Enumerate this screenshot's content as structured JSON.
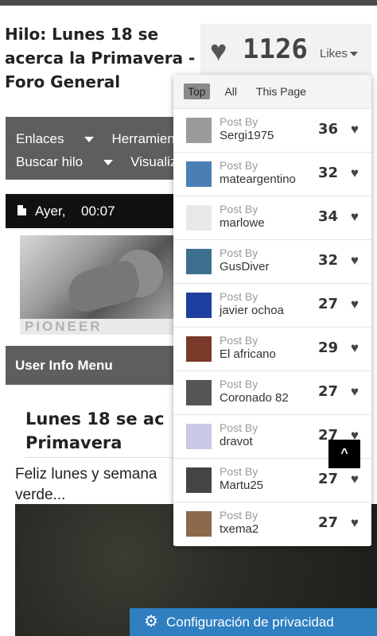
{
  "thread": {
    "title": "Hilo: Lunes 18 se acerca la Primavera - Foro General"
  },
  "navbar": {
    "items": [
      {
        "label": "Enlaces",
        "has_caret": true
      },
      {
        "label": "Herramient",
        "has_caret": false
      },
      {
        "label": "Buscar hilo",
        "has_caret": true
      },
      {
        "label": "Visualiz",
        "has_caret": false
      }
    ]
  },
  "post": {
    "date": "Ayer,",
    "time": "00:07",
    "avatar_plate_text": "PIONEER",
    "user_info_menu": "User Info Menu",
    "title": "Lunes 18 se ac Primavera",
    "title_line1": "Lunes 18 se ac",
    "title_line2": "Primavera",
    "excerpt_line1": "Feliz lunes y semana",
    "excerpt_line2": "verde..."
  },
  "likes": {
    "count": "1126",
    "label": "Likes",
    "heart_icon": "heart-icon",
    "tabs": [
      {
        "label": "Top",
        "active": true
      },
      {
        "label": "All",
        "active": false
      },
      {
        "label": "This Page",
        "active": false
      }
    ],
    "post_by_label": "Post By",
    "likers": [
      {
        "name": "Sergi1975",
        "count": "36",
        "avatar_color": "#9b9b9b"
      },
      {
        "name": "mateargentino",
        "count": "32",
        "avatar_color": "#4a7fb5"
      },
      {
        "name": "marlowe",
        "count": "34",
        "avatar_color": "#e8e8e8"
      },
      {
        "name": "GusDiver",
        "count": "32",
        "avatar_color": "#3d6f8e"
      },
      {
        "name": "javier ochoa",
        "count": "27",
        "avatar_color": "#1f3fa0"
      },
      {
        "name": "El africano",
        "count": "29",
        "avatar_color": "#7a3a2a"
      },
      {
        "name": "Coronado 82",
        "count": "27",
        "avatar_color": "#555555"
      },
      {
        "name": "dravot",
        "count": "27",
        "avatar_color": "#c9c9e8"
      },
      {
        "name": "Martu25",
        "count": "27",
        "avatar_color": "#444444"
      },
      {
        "name": "txema2",
        "count": "27",
        "avatar_color": "#8a6a4a"
      }
    ]
  },
  "scroll_top": {
    "icon": "chevron-up-icon",
    "glyph": "^"
  },
  "privacy": {
    "label": "Configuración de privacidad",
    "icon": "gear-icon",
    "color": "#2f7fc1"
  }
}
